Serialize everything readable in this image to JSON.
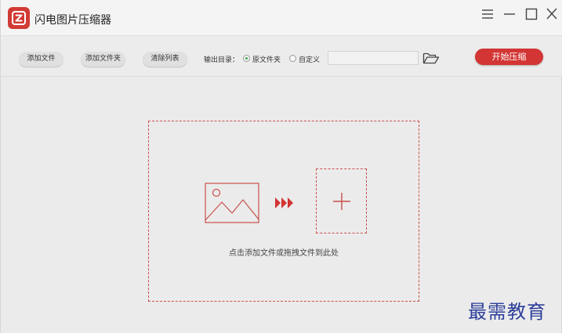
{
  "app": {
    "title": "闪电图片压缩器",
    "accent": "#d23533"
  },
  "window_controls": {
    "menu_icon": "menu-icon",
    "minimize_icon": "minimize-icon",
    "maximize_icon": "maximize-icon",
    "close_icon": "close-icon"
  },
  "toolbar": {
    "add_file_label": "添加文件",
    "add_folder_label": "添加文件夹",
    "clear_list_label": "清除列表",
    "output_dir_label": "输出目录：",
    "output_options": [
      {
        "label": "原文件夹",
        "selected": true
      },
      {
        "label": "自定义",
        "selected": false
      }
    ],
    "custom_path_value": "",
    "browse_icon": "folder-open-icon",
    "start_label": "开始压缩"
  },
  "dropzone": {
    "hint": "点击添加文件或拖拽文件到此处",
    "image_icon": "image-icon",
    "arrow_icon": "triple-arrow-icon",
    "plus_icon": "plus-icon"
  },
  "watermark": {
    "text": "最需教育"
  }
}
